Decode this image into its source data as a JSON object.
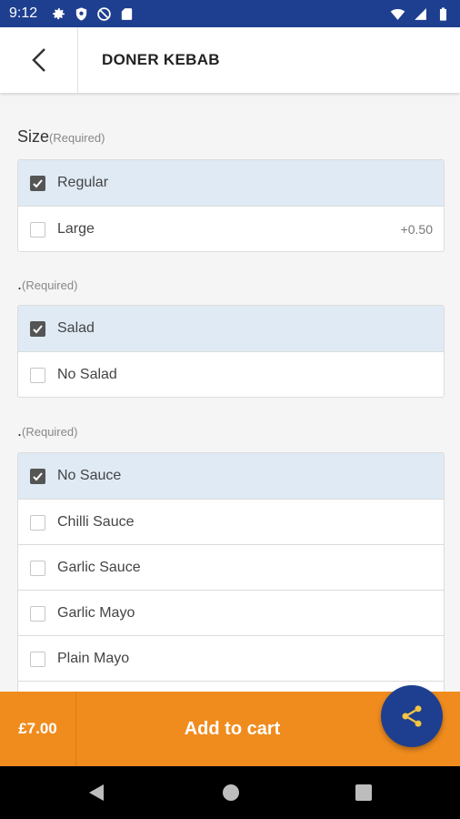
{
  "status_bar": {
    "time": "9:12",
    "left_icons": [
      "settings-icon",
      "shield-icon",
      "no-data-icon",
      "sd-card-icon"
    ],
    "right_icons": [
      "wifi-icon",
      "signal-icon",
      "battery-icon"
    ]
  },
  "header": {
    "title": "DONER KEBAB",
    "back_icon": "chevron-left-icon"
  },
  "groups": [
    {
      "title": "Size",
      "required": "(Required)",
      "options": [
        {
          "label": "Regular",
          "price": "",
          "checked": true
        },
        {
          "label": "Large",
          "price": "+0.50",
          "checked": false
        }
      ]
    },
    {
      "title": ".",
      "required": "(Required)",
      "options": [
        {
          "label": "Salad",
          "price": "",
          "checked": true
        },
        {
          "label": "No Salad",
          "price": "",
          "checked": false
        }
      ]
    },
    {
      "title": ".",
      "required": "(Required)",
      "options": [
        {
          "label": "No Sauce",
          "price": "",
          "checked": true
        },
        {
          "label": "Chilli Sauce",
          "price": "",
          "checked": false
        },
        {
          "label": "Garlic Sauce",
          "price": "",
          "checked": false
        },
        {
          "label": "Garlic Mayo",
          "price": "",
          "checked": false
        },
        {
          "label": "Plain Mayo",
          "price": "",
          "checked": false
        },
        {
          "label": "",
          "price": "",
          "checked": false
        }
      ]
    }
  ],
  "footer": {
    "price": "£7.00",
    "add_to_cart_label": "Add to cart"
  },
  "fab": {
    "icon": "share-icon"
  },
  "nav_bar": {
    "icons": [
      "back-triangle-icon",
      "home-circle-icon",
      "recents-square-icon"
    ]
  },
  "colors": {
    "primary": "#1e3f8f",
    "accent": "#f08c1e",
    "selected_row": "#dfeaf4",
    "share_icon": "#f5c542"
  }
}
